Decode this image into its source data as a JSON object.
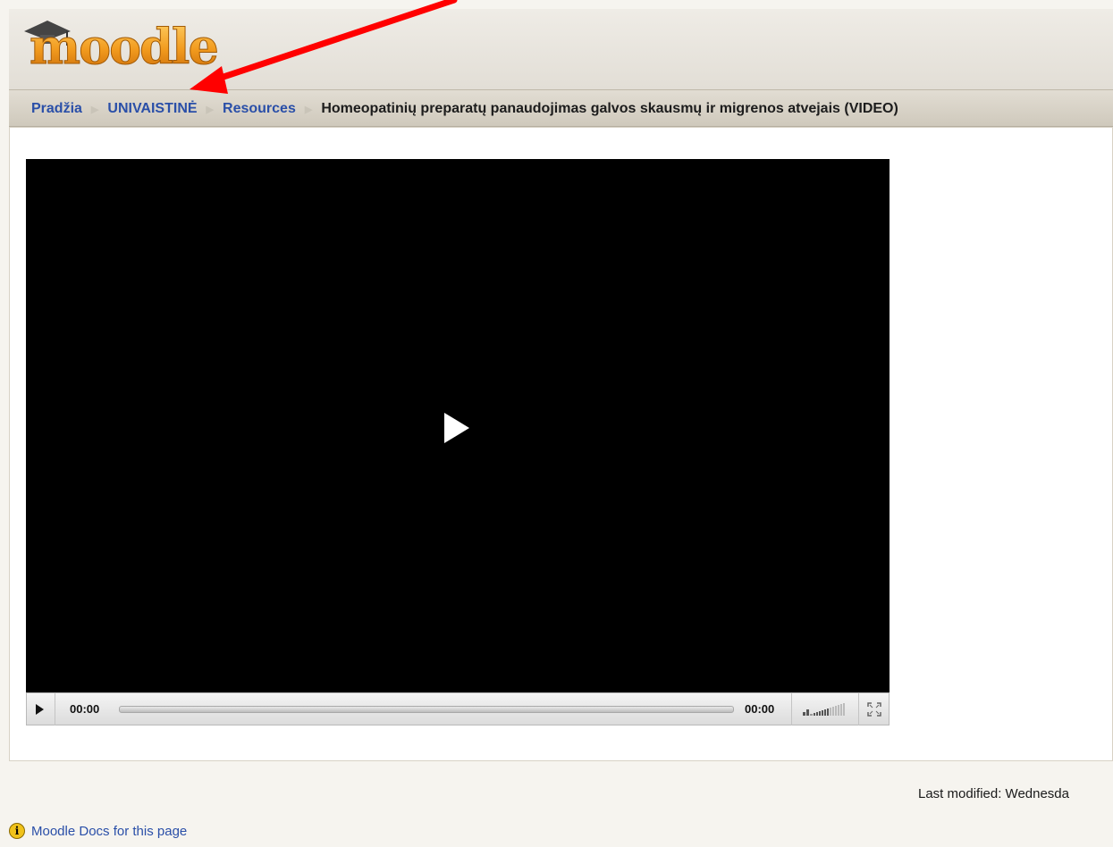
{
  "header": {
    "logo_text": "moodle"
  },
  "breadcrumb": {
    "items": [
      {
        "label": "Pradžia",
        "link": true
      },
      {
        "label": "UNIVAISTINĖ",
        "link": true
      },
      {
        "label": "Resources",
        "link": true
      },
      {
        "label": "Homeopatinių preparatų panaudojimas galvos skausmų ir migrenos atvejais (VIDEO)",
        "link": false
      }
    ]
  },
  "player": {
    "current_time": "00:00",
    "duration": "00:00",
    "progress": 0
  },
  "footer": {
    "last_modified": "Last modified: Wednesda",
    "docs_link": "Moodle Docs for this page",
    "info_icon": "i"
  },
  "colors": {
    "link": "#2a4fa8",
    "logo_orange": "#f29b1e",
    "annotation_arrow": "#ff0000"
  }
}
